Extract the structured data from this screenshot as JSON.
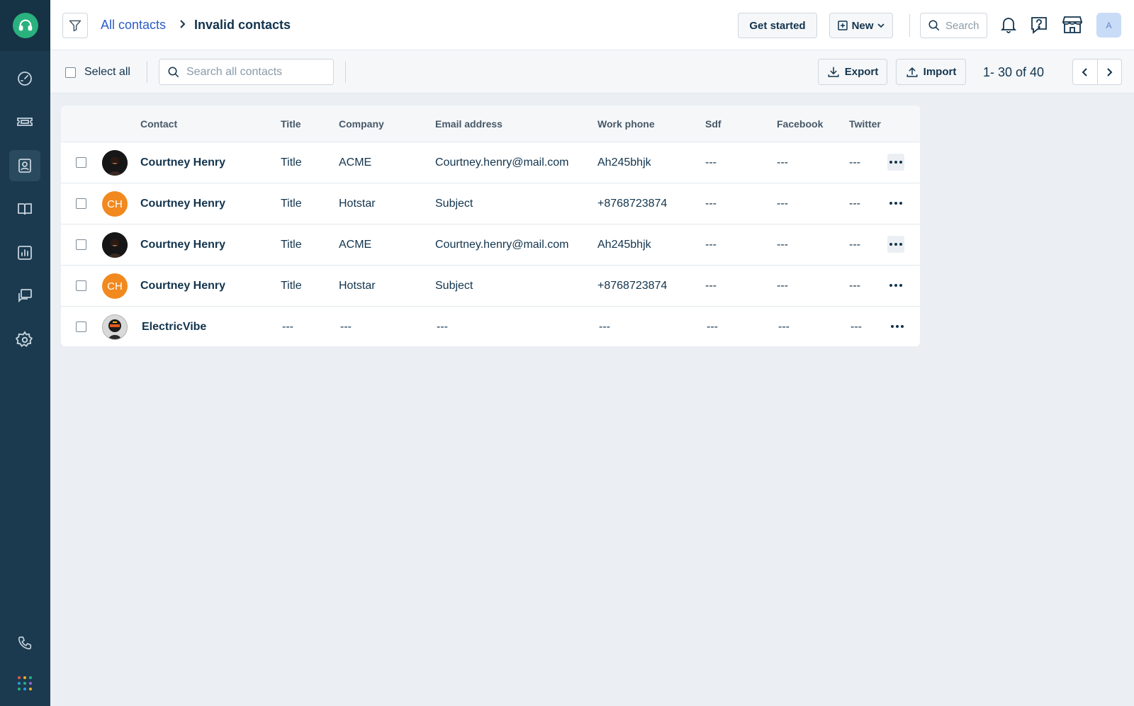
{
  "header": {
    "breadcrumb_parent": "All contacts",
    "breadcrumb_current": "Invalid contacts",
    "get_started": "Get started",
    "new": "New",
    "search_placeholder": "Search",
    "avatar_initial": "A"
  },
  "toolbar": {
    "select_all": "Select all",
    "search_placeholder": "Search all contacts",
    "export": "Export",
    "import": "Import",
    "pagination": "1- 30 of 40"
  },
  "table": {
    "columns": [
      "Contact",
      "Title",
      "Company",
      "Email address",
      "Work phone",
      "Sdf",
      "Facebook",
      "Twitter"
    ],
    "rows": [
      {
        "avatar": "photo",
        "initials": "",
        "name": "Courtney Henry",
        "title": "Title",
        "company": "ACME",
        "email": "Courtney.henry@mail.com",
        "phone": "Ah245bhjk",
        "sdf": "---",
        "facebook": "---",
        "twitter": "---"
      },
      {
        "avatar": "initials",
        "initials": "CH",
        "name": "Courtney Henry",
        "title": "Title",
        "company": "Hotstar",
        "email": "Subject",
        "phone": "+8768723874",
        "sdf": "---",
        "facebook": "---",
        "twitter": "---"
      },
      {
        "avatar": "photo",
        "initials": "",
        "name": "Courtney Henry",
        "title": "Title",
        "company": "ACME",
        "email": "Courtney.henry@mail.com",
        "phone": "Ah245bhjk",
        "sdf": "---",
        "facebook": "---",
        "twitter": "---"
      },
      {
        "avatar": "initials",
        "initials": "CH",
        "name": "Courtney Henry",
        "title": "Title",
        "company": "Hotstar",
        "email": "Subject",
        "phone": "+8768723874",
        "sdf": "---",
        "facebook": "---",
        "twitter": "---"
      },
      {
        "avatar": "moto",
        "initials": "",
        "name": "ElectricVibe",
        "title": "---",
        "company": "---",
        "email": "---",
        "phone": "---",
        "sdf": "---",
        "facebook": "---",
        "twitter": "---"
      }
    ]
  },
  "sidebar": {
    "items": [
      "dashboard-icon",
      "tickets-icon",
      "contacts-icon",
      "knowledge-base-icon",
      "reports-icon",
      "conversations-icon",
      "settings-icon"
    ],
    "bottom": [
      "phone-icon",
      "apps-grid-icon"
    ]
  },
  "colors": {
    "sidebar": "#1b3a4f",
    "brand": "#29b27e",
    "link": "#2c5cc5",
    "avatar_initials": "#f2891e"
  }
}
